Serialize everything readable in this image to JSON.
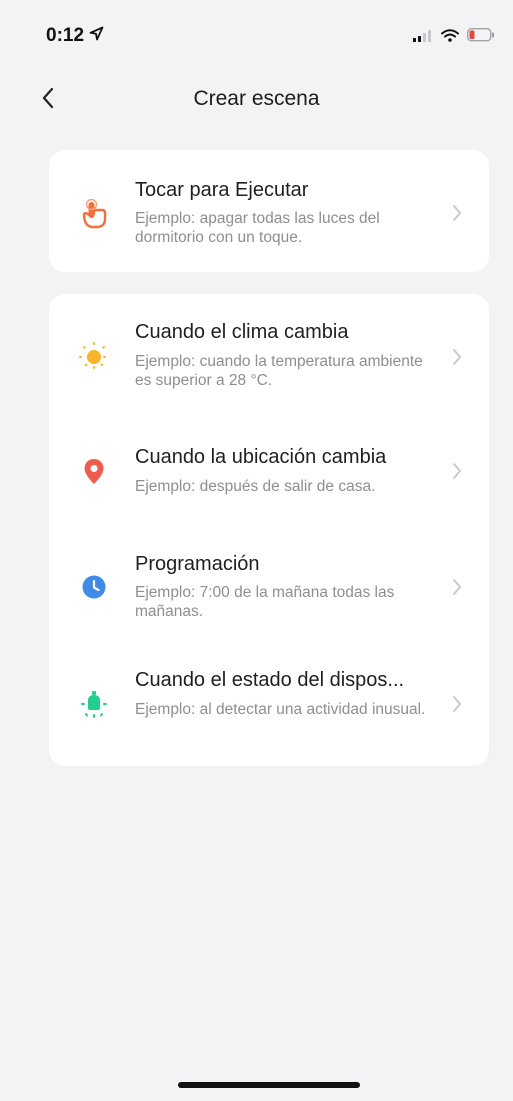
{
  "status_bar": {
    "time": "0:12",
    "icons": [
      "location-arrow-icon",
      "cellular-signal-icon",
      "wifi-icon",
      "battery-low-icon"
    ],
    "battery_color": "#e5473f"
  },
  "nav": {
    "back_icon": "chevron-left-icon",
    "title": "Crear escena"
  },
  "sections": [
    {
      "items": [
        {
          "title": "Tocar para Ejecutar",
          "description": "Ejemplo: apagar todas las luces del dormitorio con un toque.",
          "icon": "tap-hand-icon",
          "icon_color": "#f0703a"
        }
      ]
    },
    {
      "items": [
        {
          "title": "Cuando el clima cambia",
          "description": "Ejemplo: cuando la temperatura ambiente es superior a 28 °C.",
          "icon": "sun-icon",
          "icon_color": "#f7b42c"
        },
        {
          "title": "Cuando la ubicación cambia",
          "description": "Ejemplo: después de salir de casa.",
          "icon": "location-pin-icon",
          "icon_color": "#ee5b4f"
        },
        {
          "title": "Programación",
          "description": "Ejemplo: 7:00 de la mañana todas las mañanas.",
          "icon": "clock-icon",
          "icon_color": "#3f8be6"
        },
        {
          "title": "Cuando el estado del dispos...",
          "description": "Ejemplo: al detectar una actividad inusual.",
          "icon": "device-bulb-icon",
          "icon_color": "#22cf8e"
        }
      ]
    }
  ],
  "chevron_icon": "chevron-right-icon"
}
